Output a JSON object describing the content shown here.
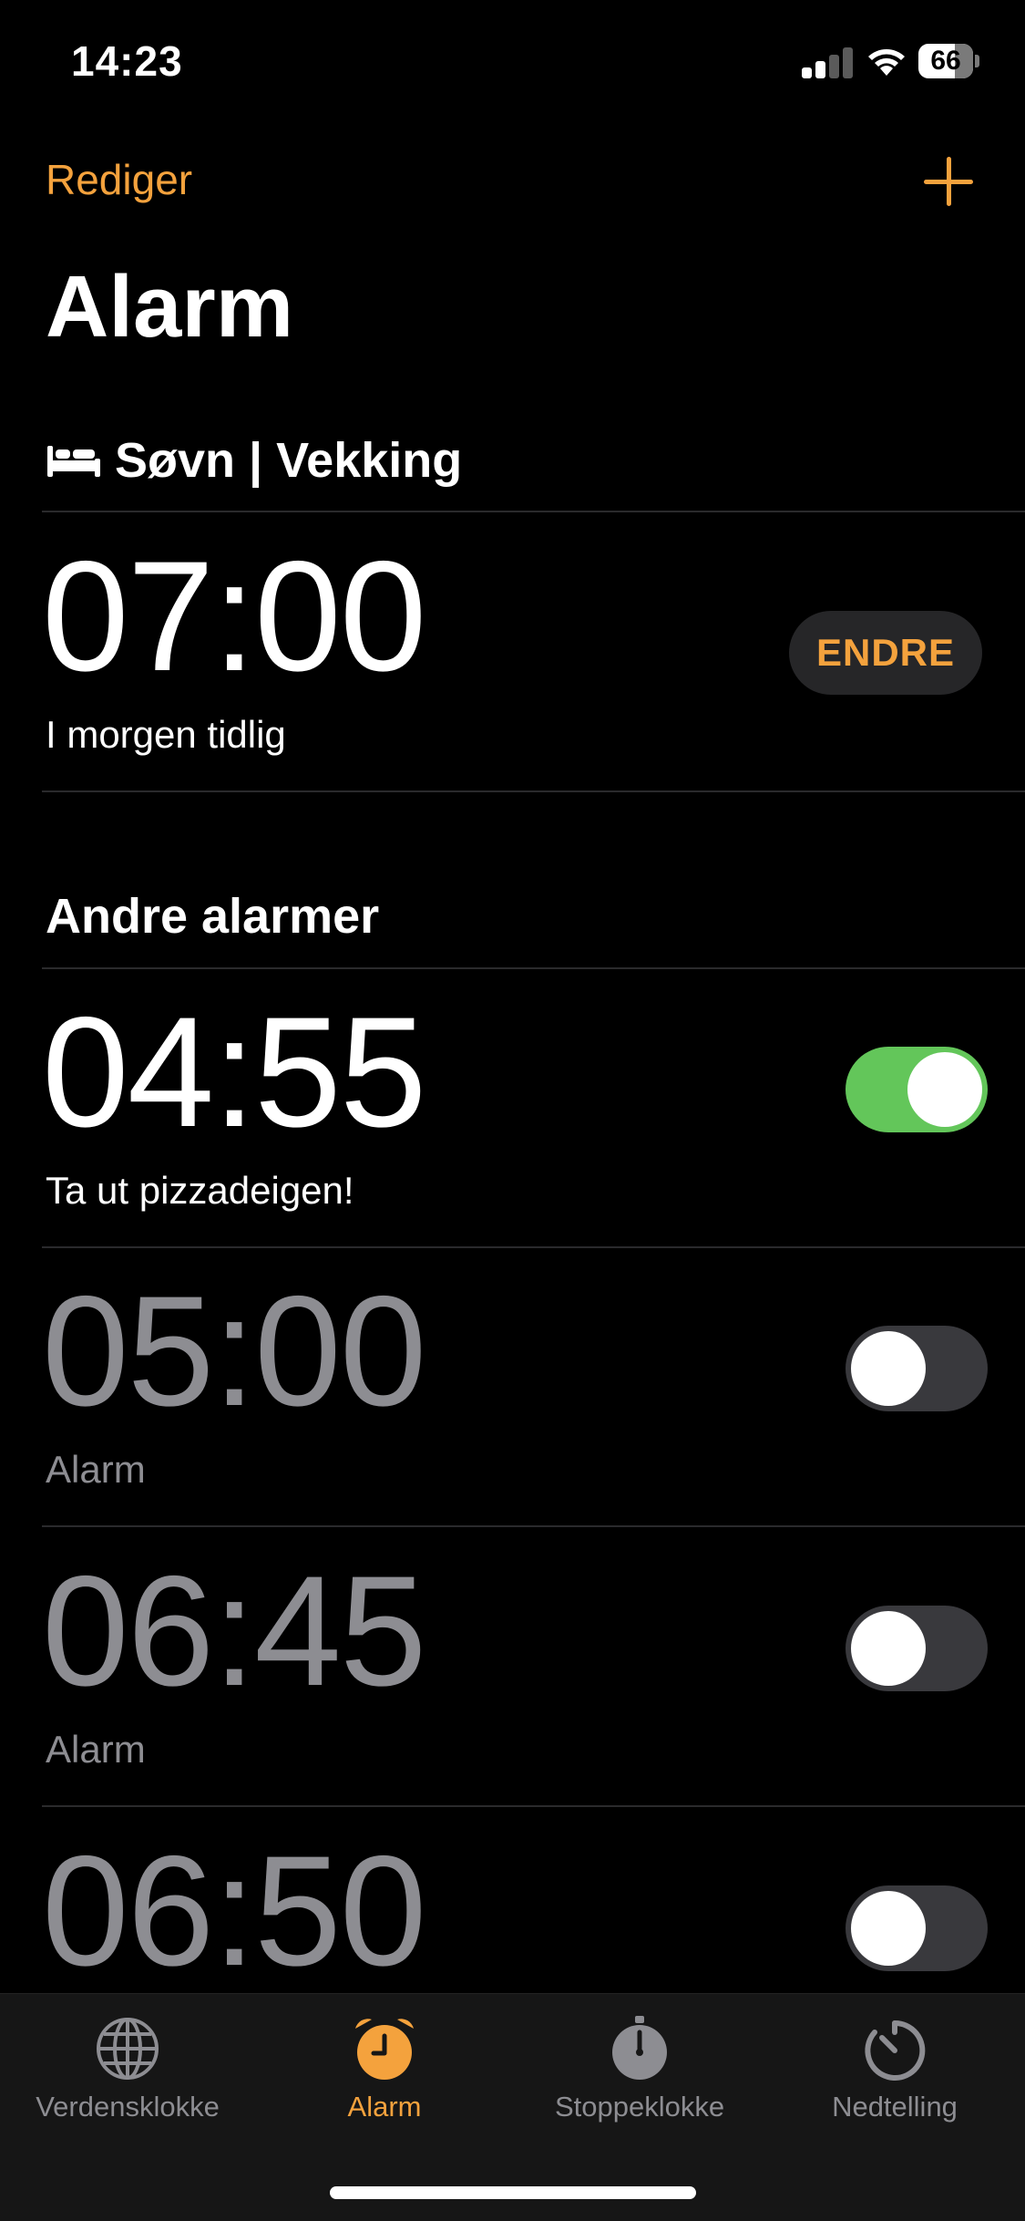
{
  "status_bar": {
    "time": "14:23",
    "battery": "66"
  },
  "header": {
    "edit_label": "Rediger",
    "title": "Alarm"
  },
  "sleep": {
    "section_title": "Søvn | Vekking",
    "time": "07:00",
    "label": "I morgen tidlig",
    "change_label": "ENDRE"
  },
  "other": {
    "section_title": "Andre alarmer",
    "alarms": [
      {
        "time": "04:55",
        "label": "Ta ut pizzadeigen!",
        "enabled": true
      },
      {
        "time": "05:00",
        "label": "Alarm",
        "enabled": false
      },
      {
        "time": "06:45",
        "label": "Alarm",
        "enabled": false
      },
      {
        "time": "06:50",
        "label": "",
        "enabled": false
      }
    ]
  },
  "tabs": [
    {
      "label": "Verdensklokke",
      "icon": "globe-icon",
      "active": false
    },
    {
      "label": "Alarm",
      "icon": "alarm-clock-icon",
      "active": true
    },
    {
      "label": "Stoppeklokke",
      "icon": "stopwatch-icon",
      "active": false
    },
    {
      "label": "Nedtelling",
      "icon": "timer-icon",
      "active": false
    }
  ],
  "colors": {
    "accent": "#f4a23d",
    "toggle_on": "#63c65a",
    "inactive_text": "#8d8d92"
  }
}
